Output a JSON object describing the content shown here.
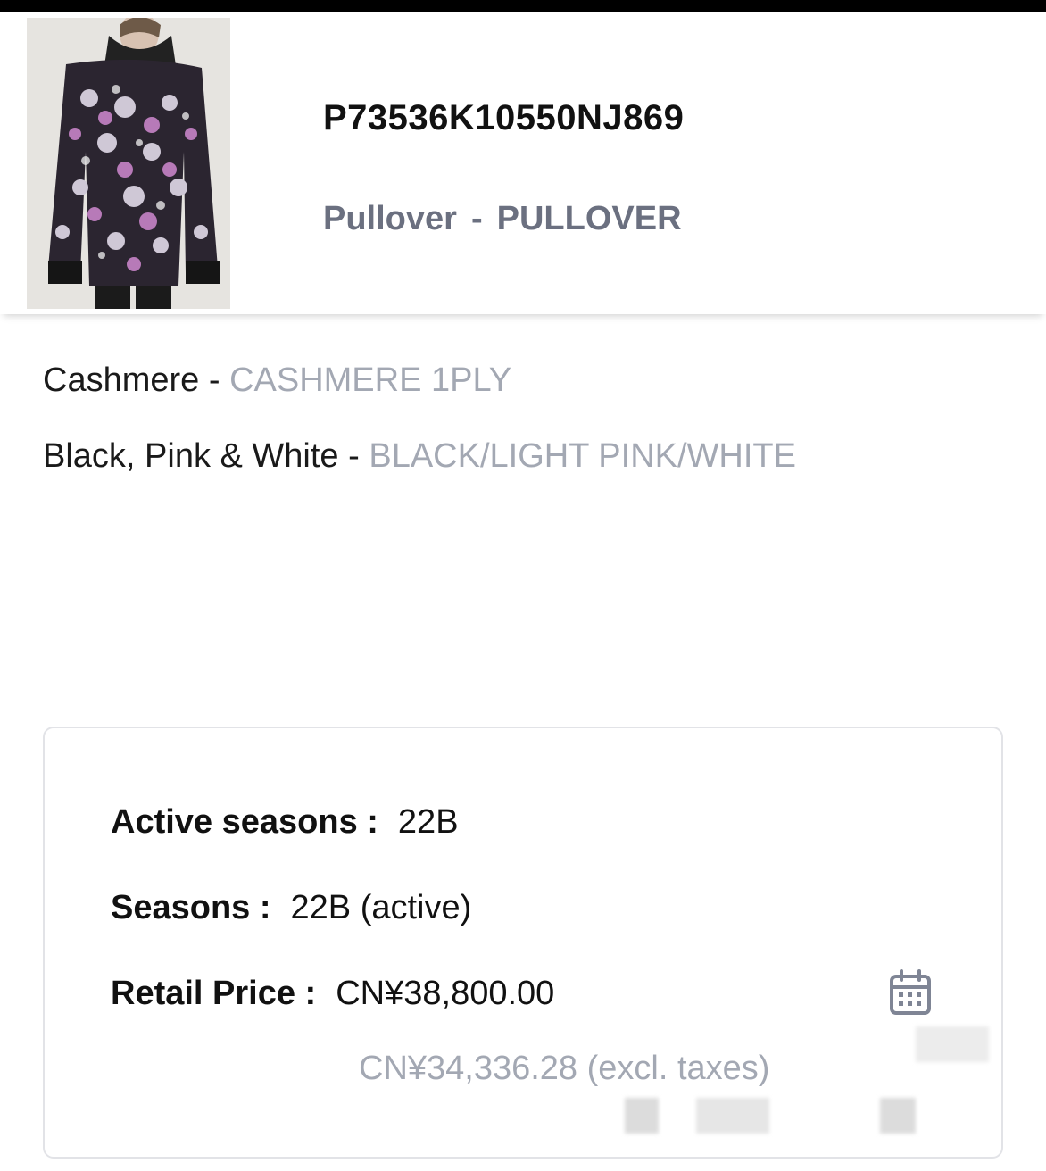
{
  "header": {
    "sku": "P73536K10550NJ869",
    "category_name": "Pullover",
    "category_separator": "-",
    "category_code": "PULLOVER",
    "image_icon": "product-photo-icon"
  },
  "specs": {
    "material_name": "Cashmere",
    "material_separator": " - ",
    "material_code": "CASHMERE 1PLY",
    "color_name": "Black, Pink & White",
    "color_separator": " - ",
    "color_code": "BLACK/LIGHT PINK/WHITE"
  },
  "details": {
    "active_seasons_label": "Active seasons :",
    "active_seasons_value": "22B",
    "seasons_label": "Seasons :",
    "seasons_value": "22B (active)",
    "retail_price_label": "Retail Price :",
    "retail_price_value": "CN¥38,800.00",
    "price_excl_taxes": "CN¥34,336.28 (excl. taxes)",
    "calendar_icon": "calendar-icon"
  },
  "colors": {
    "title": "#111111",
    "category": "#6b7080",
    "code_text": "#a3a8b3",
    "card_border": "#e2e3e7",
    "top_bar": "#000000"
  }
}
